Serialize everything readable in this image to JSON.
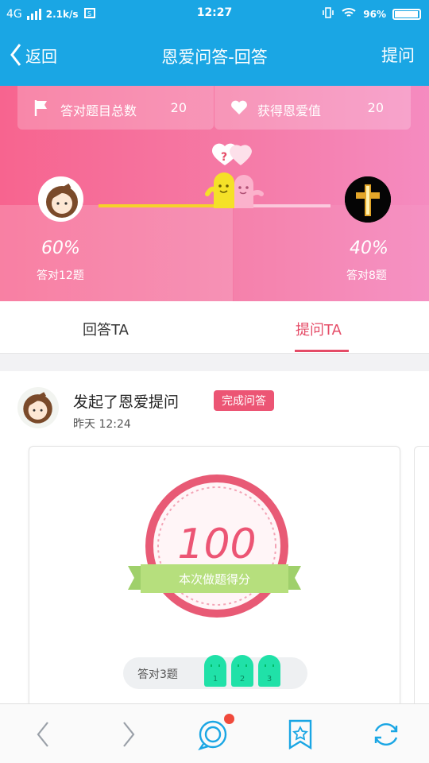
{
  "status_bar": {
    "network": "4G",
    "speed": "2.1k/s",
    "time": "12:27",
    "battery": "96%"
  },
  "nav": {
    "back_label": "返回",
    "title": "恩爱问答-回答",
    "action_label": "提问"
  },
  "stats": {
    "correct_total_label": "答对题目总数",
    "correct_total_value": "20",
    "love_value_label": "获得恩爱值",
    "love_value_value": "20",
    "left_percent": "60%",
    "left_sub": "答对12题",
    "right_percent": "40%",
    "right_sub": "答对8题",
    "question_mark": "?"
  },
  "tabs": [
    {
      "label": "回答TA"
    },
    {
      "label": "提问TA"
    }
  ],
  "feed": {
    "title": "发起了恩爱提问",
    "badge": "完成问答",
    "time": "昨天  12:24",
    "score": "100",
    "score_ribbon": "本次做题得分",
    "answered_label": "答对3题",
    "answered_marks": [
      "1",
      "2",
      "3"
    ]
  },
  "colors": {
    "nav_blue": "#1aa6e4",
    "pink": "#f57aa6",
    "accent_red": "#e54c67",
    "ribbon_green": "#b6df7d",
    "ghost_green": "#20e1a8"
  }
}
